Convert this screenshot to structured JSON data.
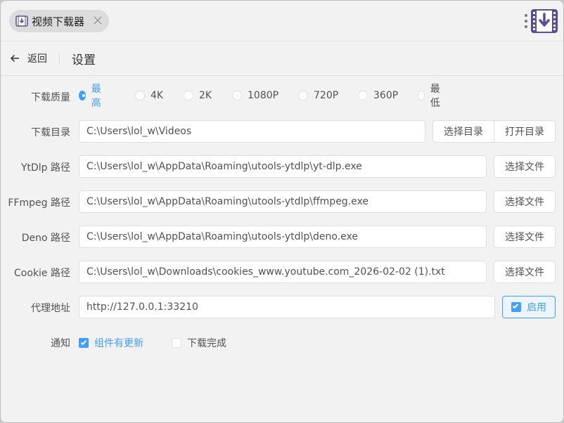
{
  "titlebar": {
    "app_title": "视频下载器"
  },
  "nav": {
    "back_label": "返回",
    "page_title": "设置"
  },
  "quality": {
    "label": "下载质量",
    "options": [
      "最高",
      "4K",
      "2K",
      "1080P",
      "720P",
      "360P",
      "最低"
    ],
    "selected": "最高"
  },
  "download_dir": {
    "label": "下载目录",
    "value": "C:\\Users\\lol_w\\Videos",
    "choose_label": "选择目录",
    "open_label": "打开目录"
  },
  "ytdlp": {
    "label": "YtDlp 路径",
    "value": "C:\\Users\\lol_w\\AppData\\Roaming\\utools-ytdlp\\yt-dlp.exe",
    "button_label": "选择文件"
  },
  "ffmpeg": {
    "label": "FFmpeg 路径",
    "value": "C:\\Users\\lol_w\\AppData\\Roaming\\utools-ytdlp\\ffmpeg.exe",
    "button_label": "选择文件"
  },
  "deno": {
    "label": "Deno 路径",
    "value": "C:\\Users\\lol_w\\AppData\\Roaming\\utools-ytdlp\\deno.exe",
    "button_label": "选择文件"
  },
  "cookie": {
    "label": "Cookie 路径",
    "value": "C:\\Users\\lol_w\\Downloads\\cookies_www.youtube.com_2026-02-02 (1).txt",
    "button_label": "选择文件"
  },
  "proxy": {
    "label": "代理地址",
    "value": "http://127.0.0.1:33210",
    "enable_label": "启用",
    "enabled": true
  },
  "notify": {
    "label": "通知",
    "component_update_label": "组件有更新",
    "component_update_checked": true,
    "download_complete_label": "下载完成",
    "download_complete_checked": false
  },
  "colors": {
    "accent": "#409eff",
    "background": "#f2f2f2",
    "logo_purple": "#5b4b9a"
  },
  "icons": [
    "film-download-icon",
    "close-icon",
    "more-vertical-icon",
    "app-logo-icon",
    "arrow-left-icon"
  ]
}
